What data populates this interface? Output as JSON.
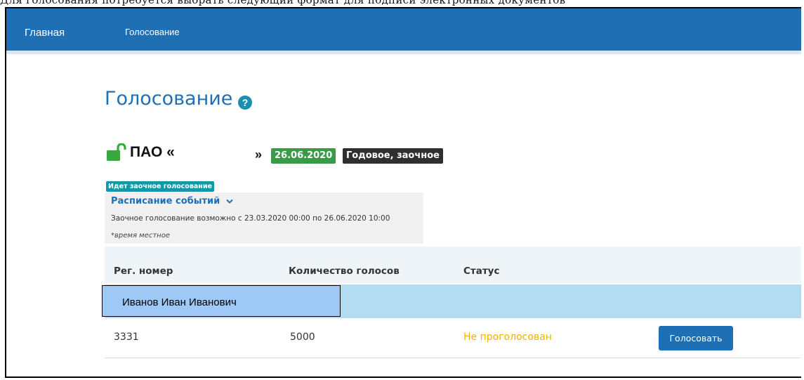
{
  "caption": "Для голосования потребуется выбрать следующий формат для подписи электронных документов",
  "nav": {
    "home": "Главная",
    "voting": "Голосование"
  },
  "page": {
    "title": "Голосование",
    "help_icon": "question-circle-icon"
  },
  "meeting": {
    "company_prefix": "ПАО «",
    "company_suffix": "»",
    "date": "26.06.2020",
    "type": "Годовое, заочное",
    "status_label": "Идет заочное голосование",
    "schedule_link": "Расписание событий",
    "schedule_text": "Заочное голосование возможно с 23.03.2020 00:00 по 26.06.2020 10:00",
    "local_time_note": "*время местное",
    "lock_icon": "unlocked-lock-icon"
  },
  "table": {
    "headers": [
      "Рег. номер",
      "Количество голосов",
      "Статус"
    ],
    "group": {
      "holder_name": "Иванов Иван Иванович"
    },
    "rows": [
      {
        "reg_number": "3331",
        "votes": "5000",
        "status": "Не проголосован",
        "action": "Голосовать"
      }
    ]
  },
  "colors": {
    "nav_bg": "#1f6fb5",
    "accent": "#1f6fb5",
    "date_badge": "#3a9a48",
    "type_badge": "#2f2f2f",
    "status_label": "#1597aa",
    "pending_status": "#f0b400",
    "group_row": "#b3dcf2",
    "holder_highlight": "#9ec8f5"
  }
}
